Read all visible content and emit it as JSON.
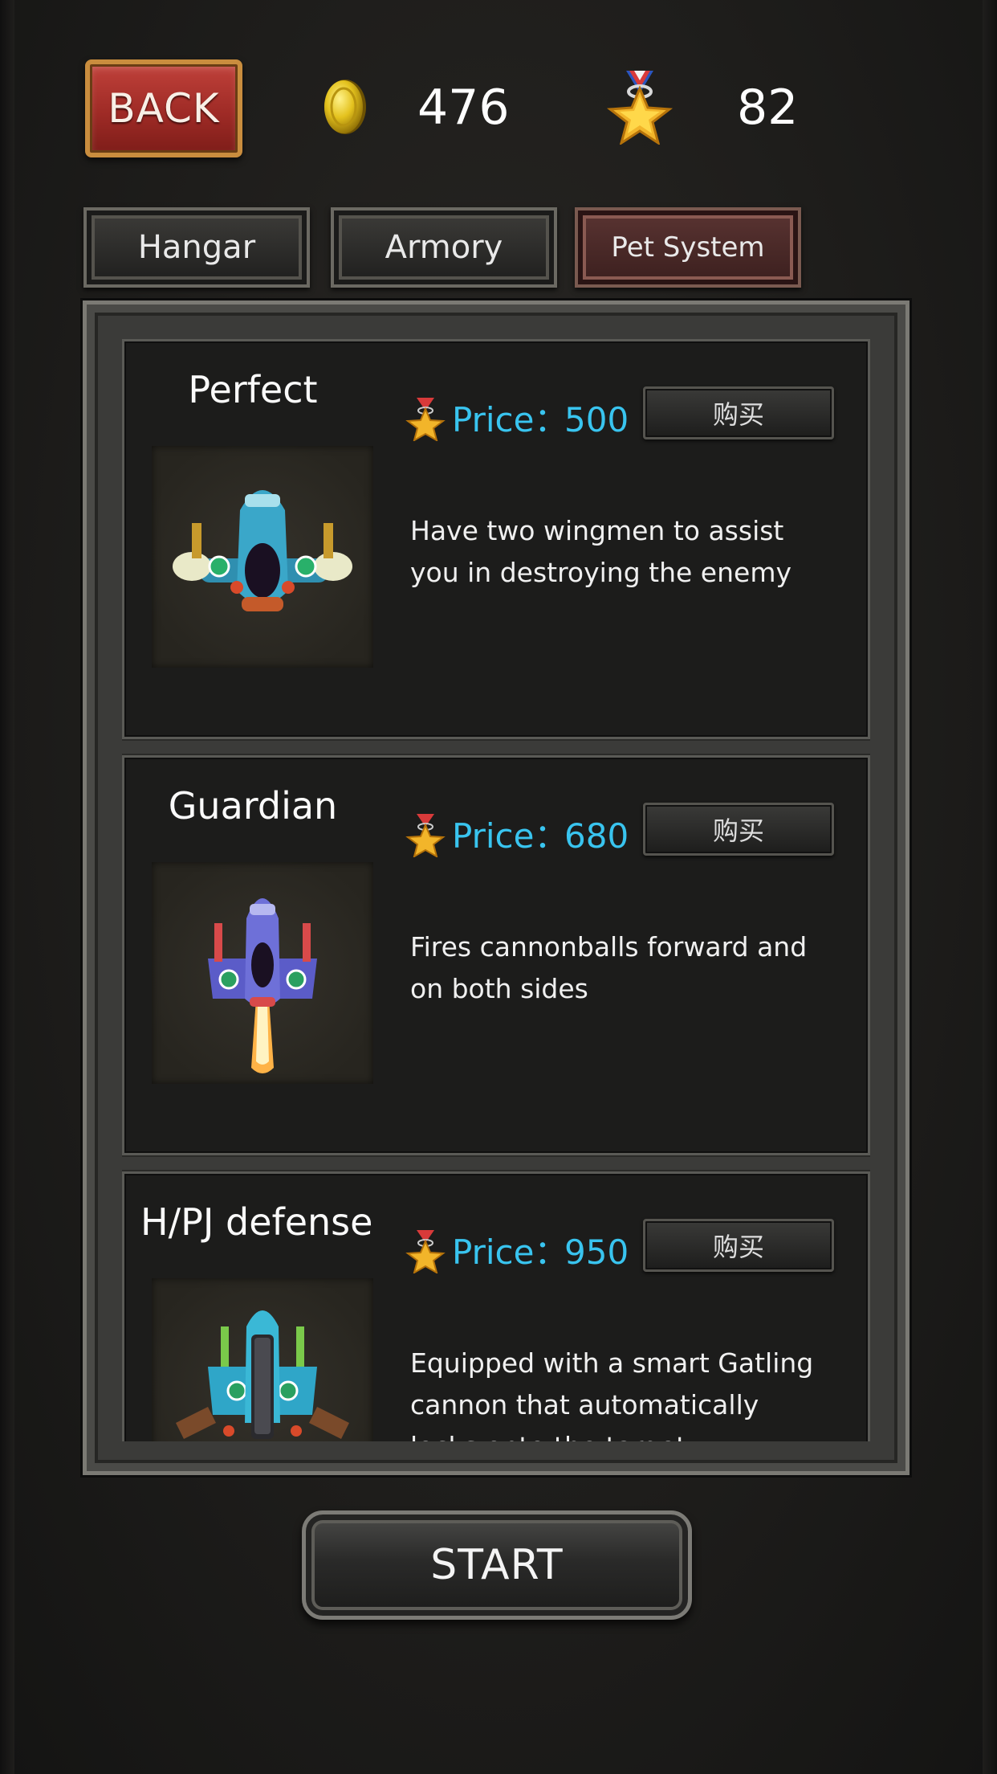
{
  "header": {
    "back_label": "BACK",
    "coins": "476",
    "medals": "82"
  },
  "tabs": [
    {
      "label": "Hangar",
      "active": false
    },
    {
      "label": "Armory",
      "active": false
    },
    {
      "label": "Pet System",
      "active": true
    }
  ],
  "items": [
    {
      "name": "Perfect",
      "price_label": "Price：",
      "price": "500",
      "buy_label": "购买",
      "description": "Have two wingmen to assist you in destroying the enemy",
      "icon": "plane-perfect-icon"
    },
    {
      "name": "Guardian",
      "price_label": "Price：",
      "price": "680",
      "buy_label": "购买",
      "description": "Fires cannonballs forward and on both sides",
      "icon": "plane-guardian-icon"
    },
    {
      "name": "H/PJ defense",
      "price_label": "Price：",
      "price": "950",
      "buy_label": "购买",
      "description": "Equipped with a smart Gatling cannon that automatically locks onto the target",
      "icon": "plane-defense-icon"
    }
  ],
  "start_label": "START",
  "colors": {
    "price": "#39c4ef",
    "back_button": "#a8302a",
    "active_tab": "#4a2826"
  }
}
